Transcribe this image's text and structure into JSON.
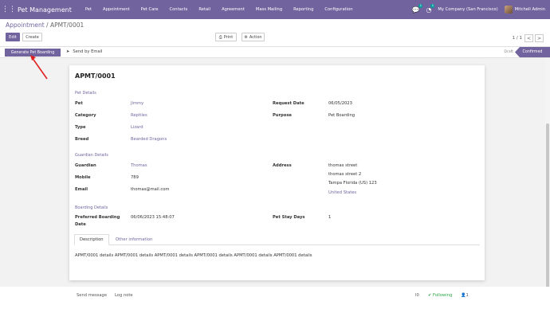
{
  "navbar": {
    "app_name": "Pet Management",
    "menu": [
      "Pet",
      "Appointment",
      "Pet Care",
      "Contacts",
      "Retail",
      "Agreement",
      "Mass Mailing",
      "Reporting",
      "Configuration"
    ],
    "messages_count": "1",
    "activities_count": "2",
    "company": "My Company (San Francisco)",
    "user": "Mitchell Admin",
    "color": "#71639e"
  },
  "breadcrumb": {
    "parent": "Appointment",
    "sep": " / ",
    "current": "APMT/0001"
  },
  "buttons": {
    "edit": "Edit",
    "create": "Create",
    "print": "Print",
    "action": "Action"
  },
  "pager": {
    "text": "1 / 1",
    "prev": "<",
    "next": ">"
  },
  "statusbar": {
    "generate": "Generate Pet Boarding",
    "send_email": "Send by Email",
    "stages": [
      "Draft",
      "Confirmed"
    ],
    "current_stage": "Confirmed"
  },
  "record": {
    "name": "APMT/0001",
    "pet_details_title": "Pet Details",
    "pet": {
      "label": "Pet",
      "value": "Jimmy"
    },
    "category": {
      "label": "Category",
      "value": "Reptiles"
    },
    "type": {
      "label": "Type",
      "value": "Lizard"
    },
    "breed": {
      "label": "Breed",
      "value": "Bearded Dragons"
    },
    "request_date": {
      "label": "Request Date",
      "value": "06/05/2023"
    },
    "purpose": {
      "label": "Purpose",
      "value": "Pet Boarding"
    },
    "guardian_details_title": "Guardian Details",
    "guardian": {
      "label": "Guardian",
      "value": "Thomas"
    },
    "mobile": {
      "label": "Mobile",
      "value": "789"
    },
    "email": {
      "label": "Email",
      "value": "thomas@mail.com"
    },
    "address": {
      "label": "Address",
      "line1": "thomas street",
      "line2": "thomas street 2",
      "line3": "Tampa  Florida (US)  123",
      "country": "United States"
    },
    "boarding_details_title": "Boarding Details",
    "preferred_boarding_date": {
      "label_line1": "Preferred Boarding",
      "label_line2": "Date",
      "value": "06/06/2023 15:48:07"
    },
    "pet_stay_days": {
      "label": "Pet Stay Days",
      "value": "1"
    },
    "tabs": [
      "Description",
      "Other information"
    ],
    "description": "APMT/0001 details APMT/0001 details APMT/0001 details APMT/0001 details APMT/0001 details APMT/0001 details"
  },
  "chatter": {
    "send_message": "Send message",
    "log_note": "Log note",
    "attachments": "0",
    "following": "Following",
    "followers": "1"
  },
  "annotation": {
    "arrow_color": "#e02020"
  }
}
